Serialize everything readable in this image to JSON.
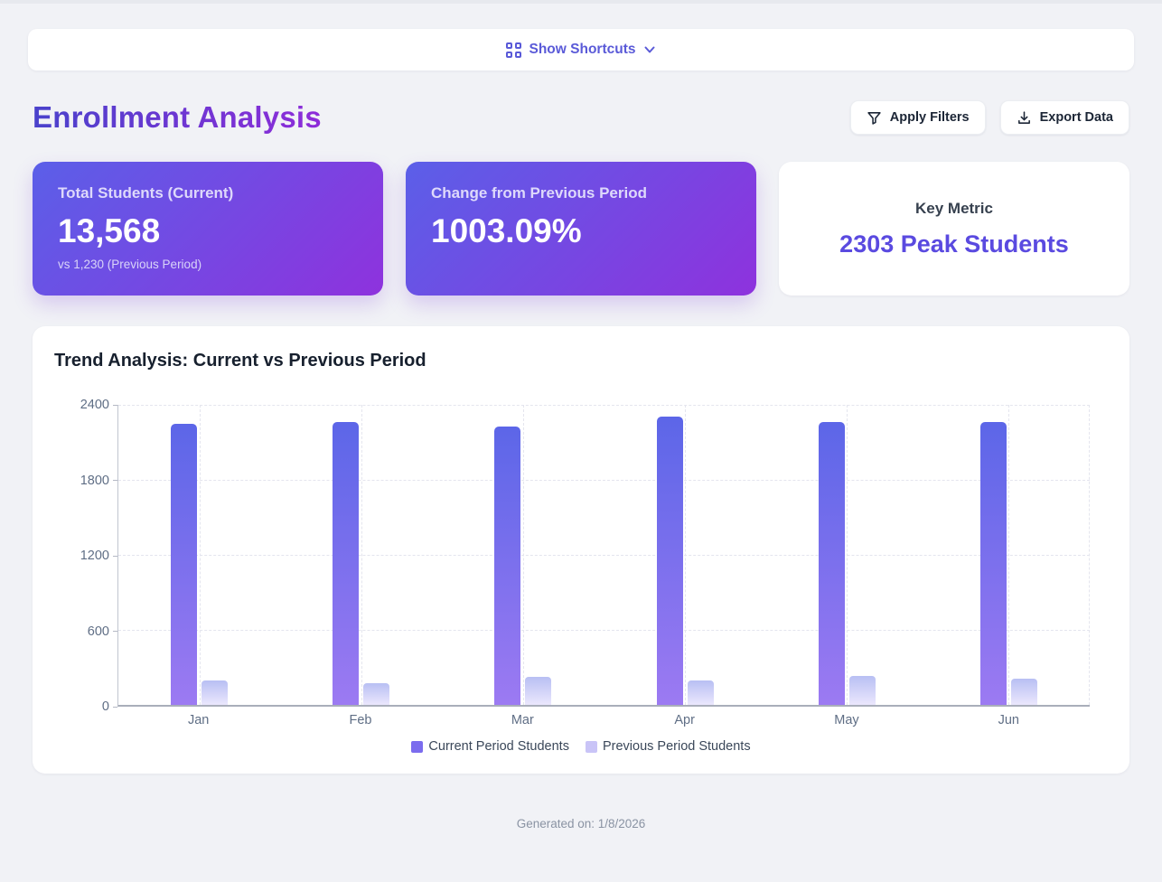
{
  "shortcuts_bar": {
    "label": "Show Shortcuts"
  },
  "header": {
    "title": "Enrollment Analysis",
    "apply_filters_label": "Apply Filters",
    "export_data_label": "Export Data"
  },
  "stats": [
    {
      "label": "Total Students (Current)",
      "value": "13,568",
      "sub": "vs 1,230 (Previous Period)"
    },
    {
      "label": "Change from Previous Period",
      "value": "1003.09%"
    },
    {
      "label": "Key Metric",
      "value": "2303 Peak Students"
    }
  ],
  "chart_card": {
    "title": "Trend Analysis: Current vs Previous Period"
  },
  "chart_data": {
    "type": "bar",
    "title": "Trend Analysis: Current vs Previous Period",
    "categories": [
      "Jan",
      "Feb",
      "Mar",
      "Apr",
      "May",
      "Jun"
    ],
    "series": [
      {
        "name": "Current Period Students",
        "values": [
          2245,
          2265,
          2230,
          2303,
          2260,
          2265
        ],
        "swatch": "#7b6cee",
        "gradient_top": "#5c66e8",
        "gradient_bottom": "#9c7af2"
      },
      {
        "name": "Previous Period Students",
        "values": [
          198,
          172,
          222,
          192,
          235,
          211
        ],
        "swatch": "#c9c4f7",
        "gradient_top": "#b8bff3",
        "gradient_bottom": "#ebe7fd"
      }
    ],
    "xlabel": "",
    "ylabel": "",
    "ylim": [
      0,
      2400
    ],
    "yticks": [
      0,
      600,
      1200,
      1800,
      2400
    ],
    "grid": true,
    "legend_position": "bottom"
  },
  "footer": {
    "text": "Generated on: 1/8/2026"
  },
  "colors": {
    "accent_indigo": "#5a5ad8",
    "title_gradient_start": "#4a42cb",
    "title_gradient_end": "#8e2cd9",
    "card_gradient_start": "#5b5fe8",
    "card_gradient_end": "#8e32dd",
    "key_metric_value": "#5a4ae0",
    "page_background": "#f1f2f6"
  }
}
